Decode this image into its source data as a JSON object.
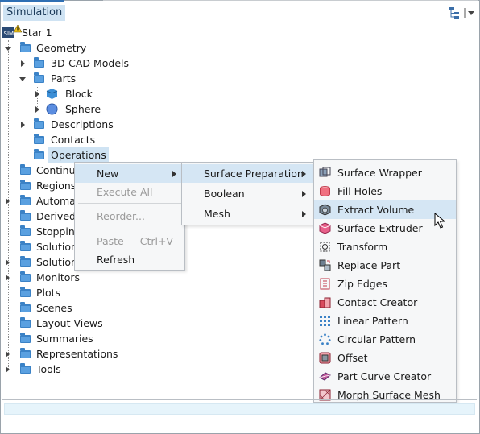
{
  "window": {
    "title": "Simulation"
  },
  "tree": {
    "root": "Star 1",
    "items": {
      "geometry": "Geometry",
      "cad": "3D-CAD Models",
      "parts": "Parts",
      "block": "Block",
      "sphere": "Sphere",
      "descriptions": "Descriptions",
      "contacts": "Contacts",
      "operations": "Operations",
      "continua": "Continua",
      "regions": "Regions",
      "automation": "Automation",
      "derived": "Derived Parts",
      "stopping": "Stopping Criteria",
      "solution1": "Solution Histories",
      "solution2": "Solution Views",
      "monitors": "Monitors",
      "plots": "Plots",
      "scenes": "Scenes",
      "layout_views": "Layout Views",
      "summaries": "Summaries",
      "representations": "Representations",
      "tools": "Tools"
    }
  },
  "context_menu": {
    "new": "New",
    "execute_all": "Execute All",
    "reorder": "Reorder...",
    "paste": "Paste",
    "paste_shortcut": "Ctrl+V",
    "refresh": "Refresh"
  },
  "new_submenu": {
    "surface_preparation": "Surface Preparation",
    "boolean": "Boolean",
    "mesh": "Mesh"
  },
  "surface_prep_submenu": {
    "items": [
      "Surface Wrapper",
      "Fill Holes",
      "Extract Volume",
      "Surface Extruder",
      "Transform",
      "Replace Part",
      "Zip Edges",
      "Contact Creator",
      "Linear Pattern",
      "Circular Pattern",
      "Offset",
      "Part Curve Creator",
      "Morph Surface Mesh"
    ],
    "selected": "Extract Volume"
  },
  "colors": {
    "selection": "#cfe3f3",
    "folder": "#3b82c6",
    "accent": "#2f6fb3"
  }
}
